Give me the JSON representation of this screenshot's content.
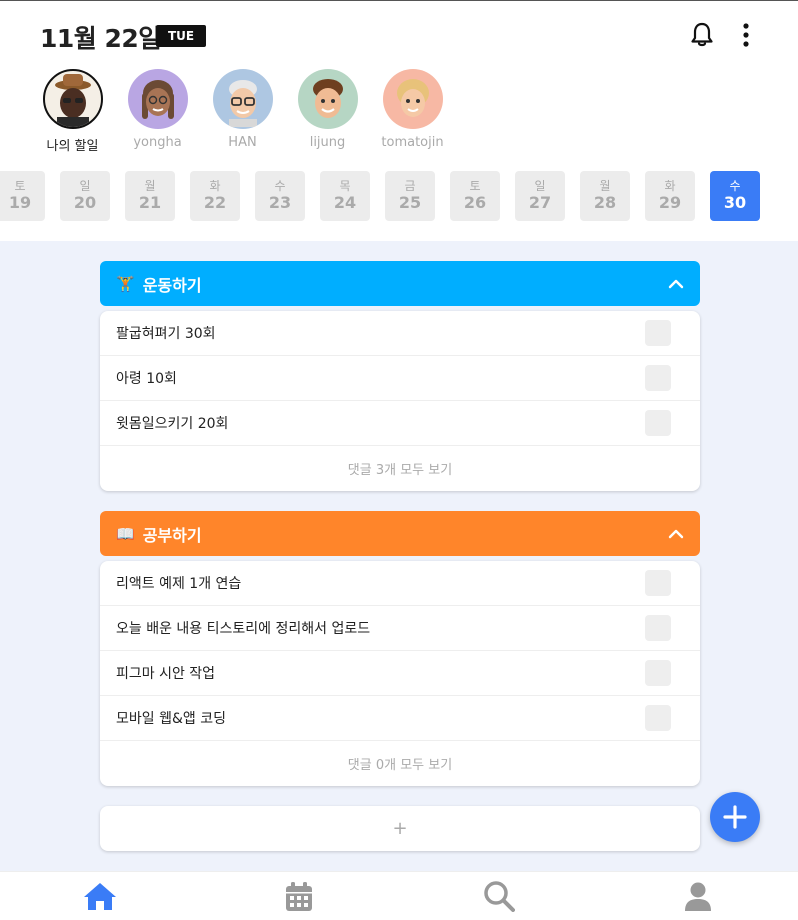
{
  "header": {
    "date": "11월 22일",
    "day_badge": "TUE"
  },
  "friends": [
    {
      "name": "나의 할일",
      "icon": "avatar-me"
    },
    {
      "name": "yongha",
      "icon": "avatar-yongha"
    },
    {
      "name": "HAN",
      "icon": "avatar-han"
    },
    {
      "name": "lijung",
      "icon": "avatar-lijung"
    },
    {
      "name": "tomatojin",
      "icon": "avatar-tomatojin"
    }
  ],
  "dates": [
    {
      "dow": "토",
      "day": "19"
    },
    {
      "dow": "일",
      "day": "20"
    },
    {
      "dow": "월",
      "day": "21"
    },
    {
      "dow": "화",
      "day": "22"
    },
    {
      "dow": "수",
      "day": "23"
    },
    {
      "dow": "목",
      "day": "24"
    },
    {
      "dow": "금",
      "day": "25"
    },
    {
      "dow": "토",
      "day": "26"
    },
    {
      "dow": "일",
      "day": "27"
    },
    {
      "dow": "월",
      "day": "28"
    },
    {
      "dow": "화",
      "day": "29"
    },
    {
      "dow": "수",
      "day": "30"
    }
  ],
  "groups": [
    {
      "emoji": "🏋",
      "title": "운동하기",
      "color": "#00aeff",
      "tasks": [
        "팔굽혀펴기 30회",
        "아령 10회",
        "윗몸일으키기 20회"
      ],
      "comments": "댓글 3개 모두 보기"
    },
    {
      "emoji": "📖",
      "title": "공부하기",
      "color": "#ff852a",
      "tasks": [
        "리액트 예제 1개 연습",
        "오늘 배운 내용 티스토리에 정리해서 업로드",
        "피그마 시안 작업",
        "모바일 웹&앱 코딩"
      ],
      "comments": "댓글 0개 모두 보기"
    }
  ],
  "add_group_label": "+",
  "accent": "#3a7cf6",
  "tabs": [
    "home-icon",
    "calendar-icon",
    "search-icon",
    "profile-icon"
  ]
}
